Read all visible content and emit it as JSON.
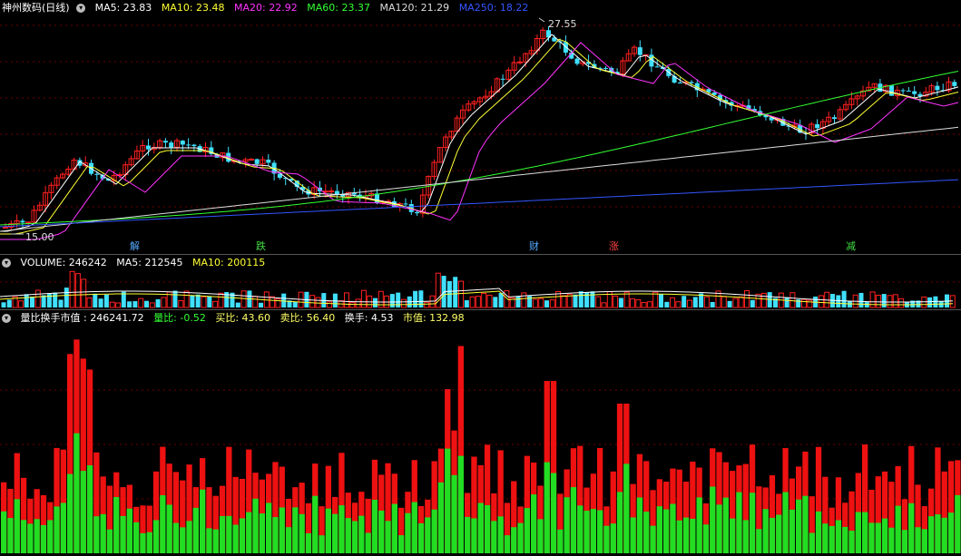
{
  "price": {
    "title": "神州数码(日线)",
    "ma": [
      {
        "label": "MA5: 23.83",
        "color": "#ffffff"
      },
      {
        "label": "MA10: 23.48",
        "color": "#ffff33"
      },
      {
        "label": "MA20: 22.92",
        "color": "#ff33ff"
      },
      {
        "label": "MA60: 23.37",
        "color": "#33ff33"
      },
      {
        "label": "MA120: 21.29",
        "color": "#dddddd"
      },
      {
        "label": "MA250: 18.22",
        "color": "#3355ff"
      }
    ],
    "high_label": "27.55",
    "low_label": "15.00",
    "markers": [
      {
        "text": "解",
        "color": "#55aaff"
      },
      {
        "text": "跌",
        "color": "#44dd44"
      },
      {
        "text": "财",
        "color": "#55aaff"
      },
      {
        "text": "涨",
        "color": "#ff4444"
      },
      {
        "text": "减",
        "color": "#44dd44"
      }
    ]
  },
  "volume": {
    "title": "VOLUME: 246242",
    "ma5": "MA5: 212545",
    "ma10": "MA10: 200115"
  },
  "ratio": {
    "title": "量比换手市值 : 246241.72",
    "liangbi": "量比: -0.52",
    "maibi": "买比: 43.60",
    "maibi2": "卖比: 56.40",
    "huanshou": "换手: 4.53",
    "shizhi": "市值: 132.98"
  },
  "colors": {
    "up": "#ff2020",
    "down": "#40e0ff",
    "green_bar": "#22dd22",
    "red_bar": "#ee1111",
    "grid": "#8b0000"
  }
}
